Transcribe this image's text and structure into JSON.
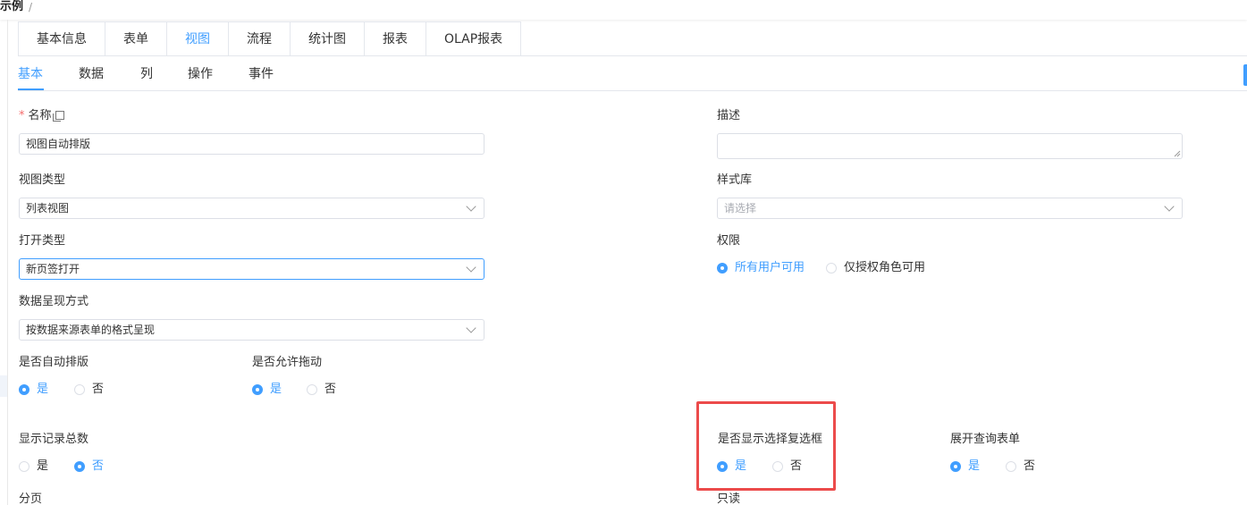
{
  "breadcrumb": {
    "current": "示例",
    "separator": "/"
  },
  "top_tabs": [
    {
      "label": "基本信息",
      "active": false
    },
    {
      "label": "表单",
      "active": false
    },
    {
      "label": "视图",
      "active": true
    },
    {
      "label": "流程",
      "active": false
    },
    {
      "label": "统计图",
      "active": false
    },
    {
      "label": "报表",
      "active": false
    },
    {
      "label": "OLAP报表",
      "active": false
    }
  ],
  "sub_tabs": [
    {
      "label": "基本",
      "active": true
    },
    {
      "label": "数据",
      "active": false
    },
    {
      "label": "列",
      "active": false
    },
    {
      "label": "操作",
      "active": false
    },
    {
      "label": "事件",
      "active": false
    }
  ],
  "form": {
    "name": {
      "label": "名称",
      "required": "*",
      "value": "视图自动排版"
    },
    "description": {
      "label": "描述",
      "value": ""
    },
    "view_type": {
      "label": "视图类型",
      "value": "列表视图"
    },
    "style_lib": {
      "label": "样式库",
      "placeholder": "请选择"
    },
    "open_type": {
      "label": "打开类型",
      "value": "新页签打开"
    },
    "permission": {
      "label": "权限",
      "options": [
        "所有用户可用",
        "仅授权角色可用"
      ],
      "selected": "所有用户可用"
    },
    "presentation": {
      "label": "数据呈现方式",
      "value": "按数据来源表单的格式呈现"
    },
    "auto_layout": {
      "label": "是否自动排版",
      "options": [
        "是",
        "否"
      ],
      "selected": "是"
    },
    "allow_drag": {
      "label": "是否允许拖动",
      "options": [
        "是",
        "否"
      ],
      "selected": "是"
    },
    "show_total": {
      "label": "显示记录总数",
      "options": [
        "是",
        "否"
      ],
      "selected": "否"
    },
    "show_checkbox": {
      "label": "是否显示选择复选框",
      "options": [
        "是",
        "否"
      ],
      "selected": "是"
    },
    "expand_query": {
      "label": "展开查询表单",
      "options": [
        "是",
        "否"
      ],
      "selected": "是"
    },
    "pagination": {
      "label": "分页"
    },
    "readonly": {
      "label": "只读"
    }
  },
  "colors": {
    "accent": "#409eff",
    "highlight": "#ec4b4b",
    "required": "#f56c6c",
    "border": "#dcdfe6"
  }
}
